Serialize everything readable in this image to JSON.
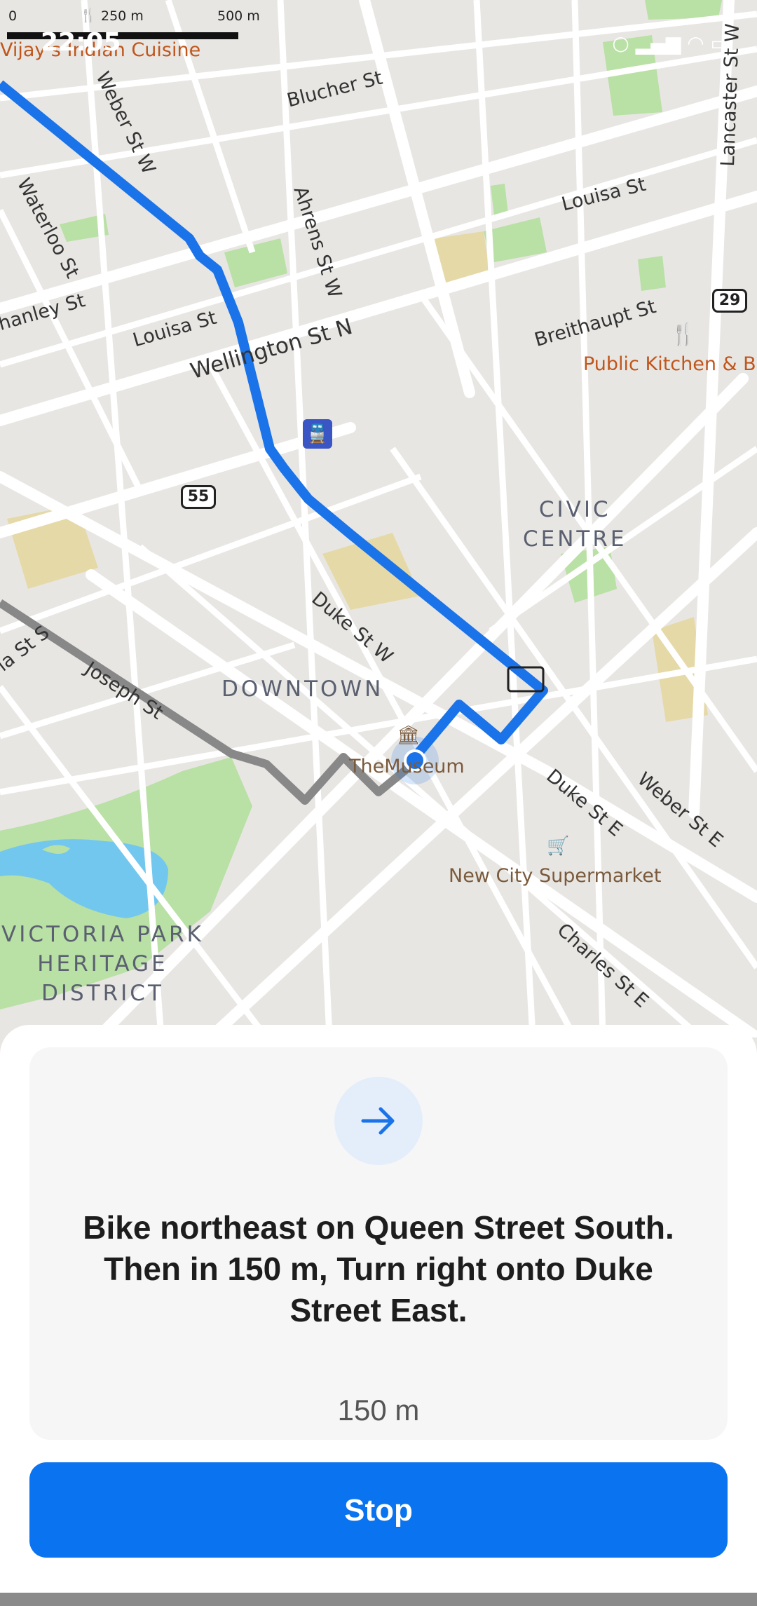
{
  "status_bar": {
    "time": "22:05",
    "icons": [
      "location-icon",
      "signal-icon",
      "wifi-icon",
      "battery-icon"
    ]
  },
  "map": {
    "scale": {
      "zero": "0",
      "mid": "250 m",
      "max": "500 m"
    },
    "streets": {
      "blucher": "Blucher St",
      "weber_w": "Weber St W",
      "waterloo": "Waterloo St",
      "ahrens": "Ahrens St W",
      "louisa_e": "Louisa St",
      "louisa_w": "Louisa St",
      "shanley": "hanley St",
      "wellington": "Wellington St N",
      "breithaupt": "Breithaupt St",
      "lancaster": "Lancaster St W",
      "duke_w": "Duke St W",
      "joseph": "Joseph St",
      "victoria_st": "ia St S",
      "duke_e": "Duke St E",
      "weber_e": "Weber St E",
      "charles": "Charles St E"
    },
    "shields": {
      "r29": "29",
      "r55": "55"
    },
    "districts": {
      "civic": "CIVIC\nCENTRE",
      "downtown": "DOWNTOWN",
      "victoria": "VICTORIA PARK\nHERITAGE\nDISTRICT"
    },
    "pois": {
      "vijay": "Vijay's Indian Cuisine",
      "public_kitchen": "Public Kitchen & B",
      "museum": "TheMuseum",
      "supermarket": "New City Supermarket"
    },
    "colors": {
      "route": "#1a73e8",
      "route_past": "#888888",
      "park": "#b9e0a5",
      "water": "#72c7ef",
      "road": "#ffffff"
    }
  },
  "navigation": {
    "direction_icon": "arrow-right-icon",
    "instruction": "Bike northeast on Queen Street South. Then in 150 m, Turn right onto Duke Street East.",
    "distance": "150 m",
    "stop_label": "Stop"
  }
}
